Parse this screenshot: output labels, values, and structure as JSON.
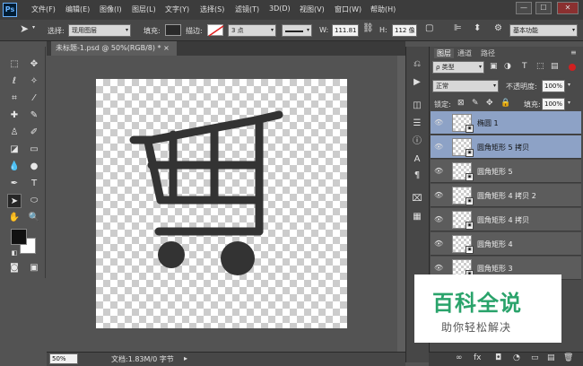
{
  "app": {
    "logo": "Ps"
  },
  "menu": [
    "文件(F)",
    "编辑(E)",
    "图像(I)",
    "图层(L)",
    "文字(Y)",
    "选择(S)",
    "滤镜(T)",
    "3D(D)",
    "视图(V)",
    "窗口(W)",
    "帮助(H)"
  ],
  "window": {
    "minimize": "—",
    "maximize": "☐",
    "close": "✕"
  },
  "options": {
    "select_label": "选择:",
    "select_value": "现用图层",
    "fill_label": "填充:",
    "stroke_label": "描边:",
    "stroke_value": "3 点",
    "w_label": "W:",
    "w_value": "111.81",
    "h_label": "H:",
    "h_value": "112 像",
    "workspace": "基本功能",
    "fill_color": "#2a2a2a"
  },
  "document": {
    "tab_title": "未标题-1.psd @ 50%(RGB/8) *",
    "tab_close": "×",
    "zoom": "50%",
    "doc_info": "文档:1.83M/0 字节",
    "artwork_color": "#333333"
  },
  "layers_panel": {
    "tabs": [
      "图层",
      "通道",
      "路径"
    ],
    "filter_label": "ρ 类型",
    "blend_mode": "正常",
    "opacity_label": "不透明度:",
    "opacity_value": "100%",
    "lock_label": "锁定:",
    "fill_label": "填充:",
    "fill_value": "100%",
    "layers": [
      {
        "name": "椭圆 1",
        "selected": true
      },
      {
        "name": "圆角矩形 5 拷贝",
        "selected": true
      },
      {
        "name": "圆角矩形 5",
        "selected": false
      },
      {
        "name": "圆角矩形 4 拷贝 2",
        "selected": false
      },
      {
        "name": "圆角矩形 4 拷贝",
        "selected": false
      },
      {
        "name": "圆角矩形 4",
        "selected": false
      },
      {
        "name": "圆角矩形 3",
        "selected": false
      }
    ],
    "bottom_icons": [
      "∞",
      "fx",
      "◘",
      "◔",
      "▭",
      "▤",
      "🗑"
    ]
  },
  "watermark": {
    "title": "百科全说",
    "subtitle": "助你轻松解决",
    "color": "#2aa36b"
  }
}
